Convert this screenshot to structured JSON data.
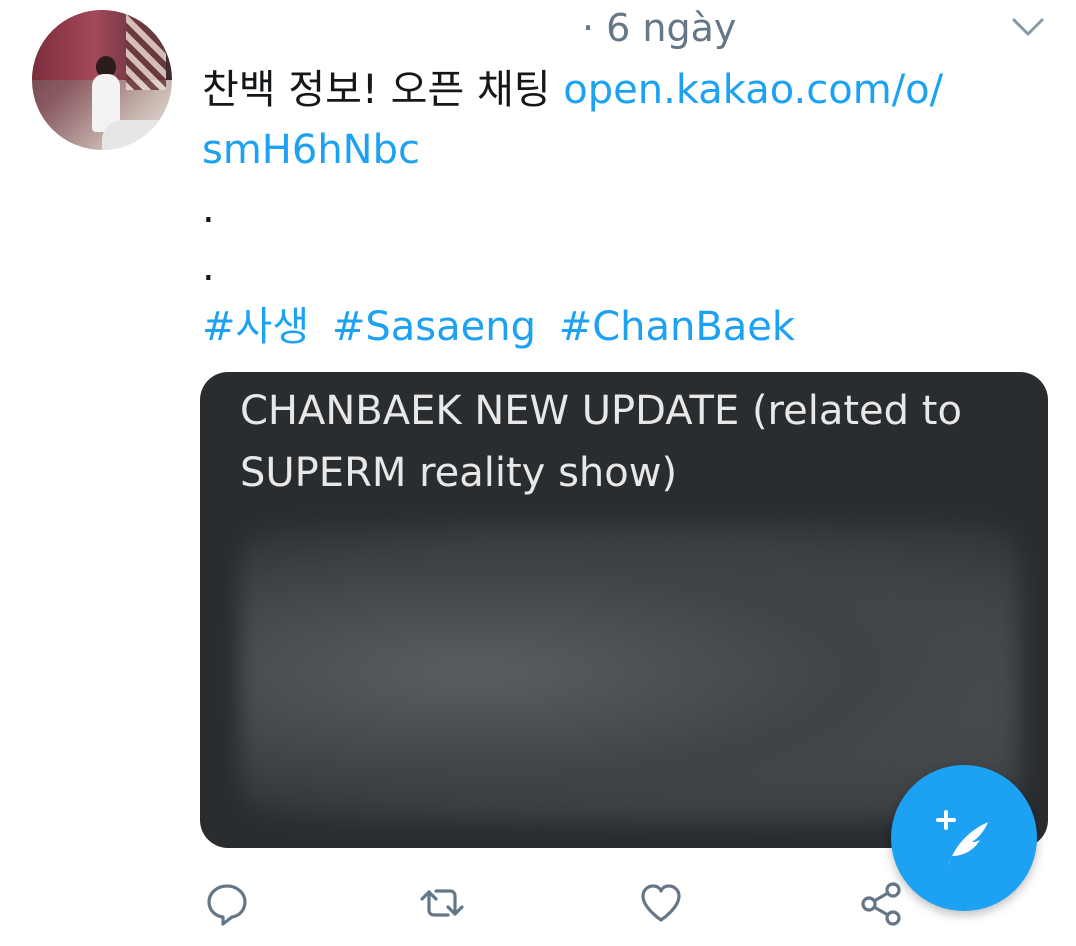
{
  "tweet": {
    "avatar_alt": "user avatar",
    "timestamp": "· 6 ngày",
    "text_prefix": "찬백 정보! 오픈 채팅 ",
    "link_line1": "open.kakao.com/o/",
    "link_line2": "smH6hNbc",
    "dot1": ".",
    "dot2": ".",
    "hashtags": [
      "#사생",
      "#Sasaeng",
      "#ChanBaek"
    ],
    "media_caption": "CHANBAEK NEW UPDATE (related to SUPERM reality show)"
  },
  "actions": {
    "reply_icon": "reply-icon",
    "retweet_icon": "retweet-icon",
    "like_icon": "heart-icon",
    "share_icon": "share-icon"
  },
  "fab": {
    "icon": "compose-tweet-icon"
  },
  "colors": {
    "accent": "#1da1f2",
    "muted": "#657786",
    "text": "#14171a",
    "media_bg": "#2a2d30"
  }
}
